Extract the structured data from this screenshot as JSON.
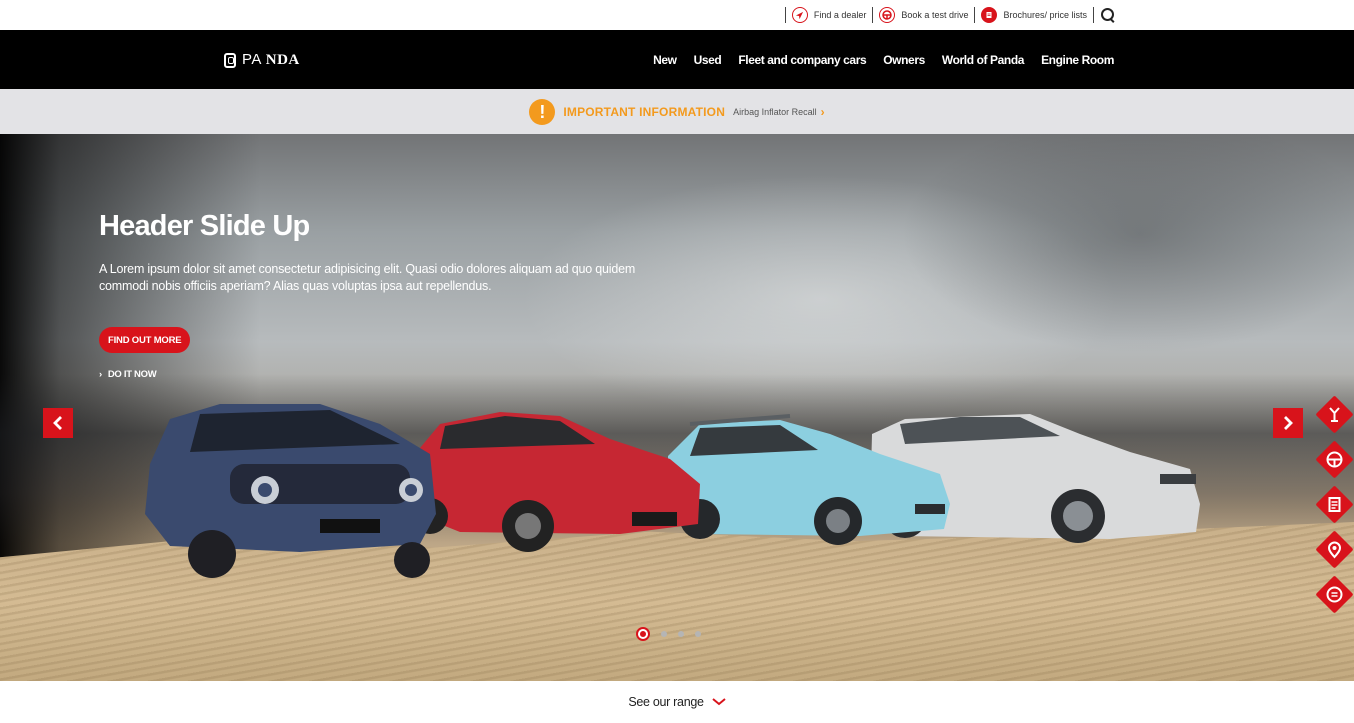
{
  "utility": {
    "find_dealer": "Find a dealer",
    "test_drive": "Book a test drive",
    "brochures": "Brochures/ price lists"
  },
  "brand": {
    "logo_prefix": "PA",
    "logo_suffix": "NDA",
    "accent": "#d8131b"
  },
  "nav": {
    "items": [
      "New",
      "Used",
      "Fleet and company cars",
      "Owners",
      "World of Panda",
      "Engine Room"
    ]
  },
  "info": {
    "icon_glyph": "!",
    "title": "IMPORTANT INFORMATION",
    "link": "Airbag Inflator Recall",
    "color": "#f39a1e"
  },
  "hero": {
    "title": "Header Slide Up",
    "description": "A Lorem ipsum dolor sit amet consectetur adipisicing elit. Quasi odio dolores aliquam ad quo quidem commodi nobis officiis aperiam? Alias quas voluptas ipsa aut repellendus.",
    "cta": "FIND OUT MORE",
    "secondary_link": "DO IT NOW",
    "slides_total": 4,
    "active_slide": 1
  },
  "quick_links": [
    "wrench-icon",
    "steering-wheel-icon",
    "brochure-icon",
    "location-pin-icon",
    "list-icon"
  ],
  "footer": {
    "see_range": "See our range"
  }
}
